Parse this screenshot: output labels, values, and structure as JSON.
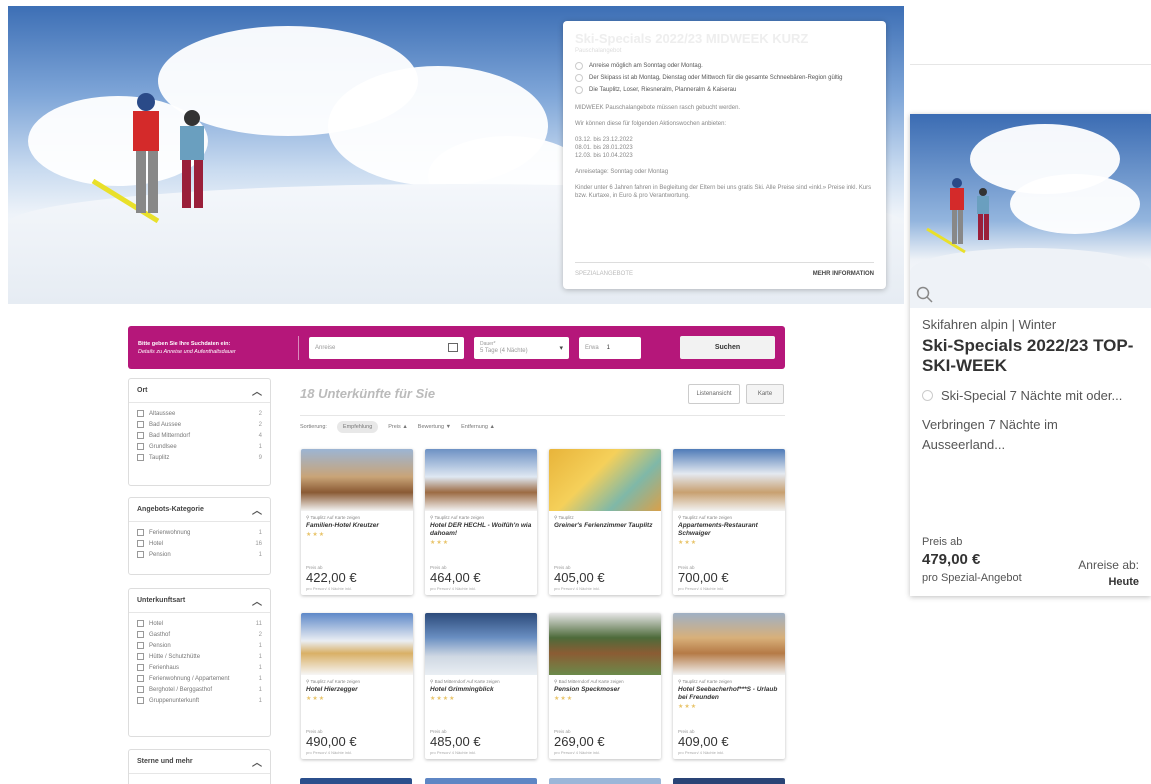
{
  "hero_card": {
    "title": "Ski-Specials 2022/23 MIDWEEK KURZ",
    "subtitle": "Pauschalangebot",
    "bullets": [
      "Anreise möglich am Sonntag oder Montag.",
      "Der Skipass ist ab Montag, Dienstag oder Mittwoch für die gesamte Schneebären-Region gültig",
      "Die Tauplitz, Loser, Riesneralm, Planneralm & Kaiserau"
    ],
    "p1": "MIDWEEK Pauschalangebote müssen rasch gebucht werden.",
    "p2": "Wir können diese für folgenden Aktionswochen anbieten:",
    "dates": [
      "03.12. bis 23.12.2022",
      "08.01. bis 28.01.2023",
      "12.03. bis 10.04.2023"
    ],
    "p3": "Anreisetage: Sonntag oder Montag",
    "p4": "Kinder unter 6 Jahren fahren in Begleitung der Eltern bei uns gratis Ski. Alle Preise sind «inkl.» Preise inkl. Kurs bzw. Kurtaxe, in Euro & pro Verantwortung.",
    "foot_left": "SPEZIALANGEBOTE",
    "more": "MEHR INFORMATION"
  },
  "side_card": {
    "category": "Skifahren alpin | Winter",
    "title": "Ski-Specials 2022/23 TOP-SKI-WEEK",
    "feature": "Ski-Special 7 Nächte mit oder...",
    "description": "Verbringen 7 Nächte im Ausseerland...",
    "price_label": "Preis ab",
    "price": "479,00 €",
    "per": "pro Spezial-Angebot",
    "arrival_label": "Anreise ab:",
    "arrival_value": "Heute"
  },
  "search": {
    "intro_title": "Bitte geben Sie Ihre Suchdaten ein:",
    "intro_sub": "Details zu Anreise und Aufenthaltsdauer",
    "arrival_placeholder": "Anreise",
    "duration_label": "Dauer*",
    "duration_value": "5 Tage (4 Nächte)",
    "adults_label": "Erwa",
    "adults_value": "1",
    "button": "Suchen",
    "accent": "#b5177a"
  },
  "filters": [
    {
      "title": "Ort",
      "items": [
        {
          "label": "Altaussee",
          "count": "2"
        },
        {
          "label": "Bad Aussee",
          "count": "2"
        },
        {
          "label": "Bad Mitterndorf",
          "count": "4"
        },
        {
          "label": "Grundlsee",
          "count": "1"
        },
        {
          "label": "Tauplitz",
          "count": "9"
        }
      ]
    },
    {
      "title": "Angebots-Kategorie",
      "items": [
        {
          "label": "Ferienwohnung",
          "count": "1"
        },
        {
          "label": "Hotel",
          "count": "16"
        },
        {
          "label": "Pension",
          "count": "1"
        }
      ]
    },
    {
      "title": "Unterkunftsart",
      "items": [
        {
          "label": "Hotel",
          "count": "11"
        },
        {
          "label": "Gasthof",
          "count": "2"
        },
        {
          "label": "Pension",
          "count": "1"
        },
        {
          "label": "Hütte / Schutzhütte",
          "count": "1"
        },
        {
          "label": "Ferienhaus",
          "count": "1"
        },
        {
          "label": "Ferienwohnung / Appartement",
          "count": "1"
        },
        {
          "label": "Berghotel / Berggasthof",
          "count": "1"
        },
        {
          "label": "Gruppenunterkunft",
          "count": "1"
        }
      ]
    },
    {
      "title": "Sterne und mehr",
      "items": []
    }
  ],
  "results": {
    "title": "18 Unterkünfte für Sie",
    "view_list": "Listenansicht",
    "view_map": "Karte",
    "sort": {
      "label": "Sortierung:",
      "active": "Empfehlung",
      "price": "Preis ▲",
      "rating": "Bewertung ▼",
      "distance": "Entfernung ▲"
    },
    "hotels": [
      {
        "loc": "Tauplitz  Auf Karte zeigen",
        "name": "Familien-Hotel Kreutzer",
        "stars": "★★★",
        "price_label": "Preis ab",
        "price": "422,00 €",
        "per": "pro Person/ 4 Nächte inkl."
      },
      {
        "loc": "Tauplitz  Auf Karte zeigen",
        "name": "Hotel DER HECHL - Woifüh'n wia dahoam!",
        "stars": "★★★",
        "price_label": "Preis ab",
        "price": "464,00 €",
        "per": "pro Person/ 4 Nächte inkl."
      },
      {
        "loc": "Tauplitz",
        "name": "Greiner's Ferienzimmer Tauplitz",
        "stars": "",
        "price_label": "Preis ab",
        "price": "405,00 €",
        "per": "pro Person/ 4 Nächte inkl."
      },
      {
        "loc": "Tauplitz  Auf Karte zeigen",
        "name": "Appartements-Restaurant Schwaiger",
        "stars": "★★★",
        "price_label": "Preis ab",
        "price": "700,00 €",
        "per": "pro Person/ 4 Nächte inkl."
      },
      {
        "loc": "Tauplitz  Auf Karte zeigen",
        "name": "Hotel Hierzegger",
        "stars": "★★★",
        "price_label": "Preis ab",
        "price": "490,00 €",
        "per": "pro Person/ 4 Nächte inkl."
      },
      {
        "loc": "Bad Mitterndorf  Auf Karte zeigen",
        "name": "Hotel Grimmingblick",
        "stars": "★★★★",
        "price_label": "Preis ab",
        "price": "485,00 €",
        "per": "pro Person/ 4 Nächte inkl."
      },
      {
        "loc": "Bad Mitterndorf  Auf Karte zeigen",
        "name": "Pension Speckmoser",
        "stars": "★★★",
        "price_label": "Preis ab",
        "price": "269,00 €",
        "per": "pro Person/ 4 Nächte inkl."
      },
      {
        "loc": "Tauplitz  Auf Karte zeigen",
        "name": "Hotel Seebacherhof***S - Urlaub bei Freunden",
        "stars": "★★★",
        "price_label": "Preis ab",
        "price": "409,00 €",
        "per": "pro Person/ 4 Nächte inkl."
      }
    ]
  }
}
